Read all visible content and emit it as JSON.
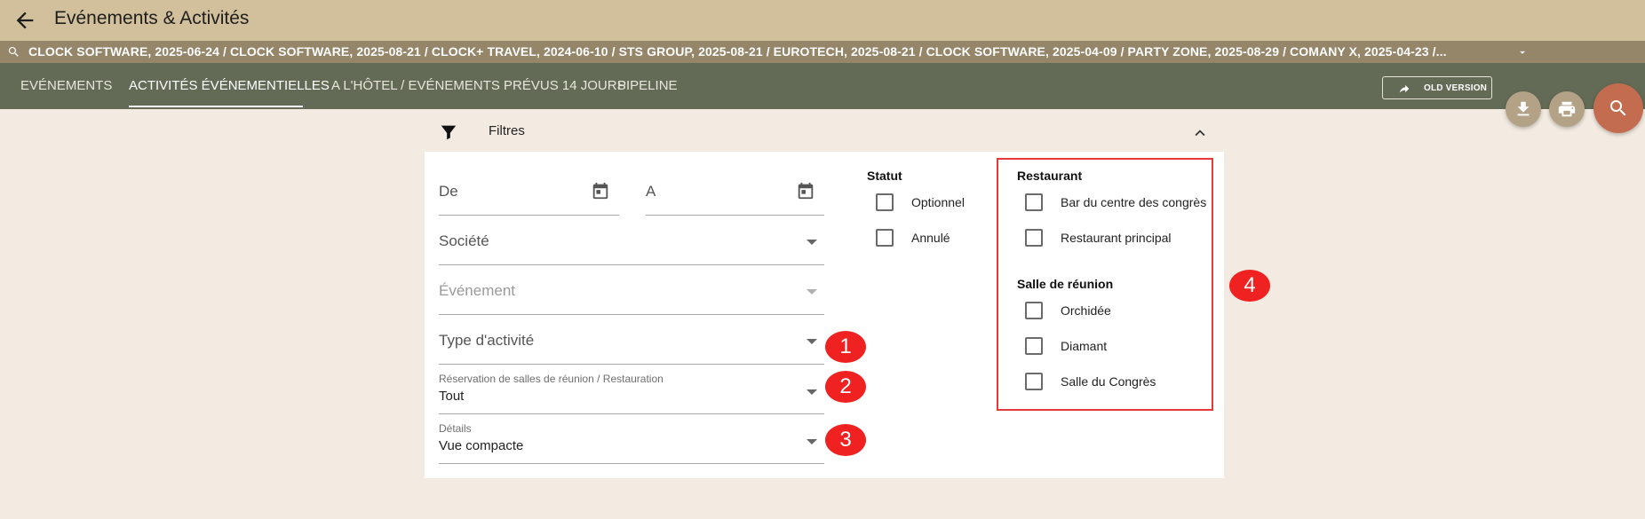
{
  "app": {
    "title": "Evénements & Activités"
  },
  "breadcrumbs": {
    "text": "CLOCK SOFTWARE, 2025-06-24  /  CLOCK SOFTWARE, 2025-08-21  /  CLOCK+ TRAVEL, 2024-06-10  /  STS GROUP, 2025-08-21  /  EUROTECH, 2025-08-21  /  CLOCK SOFTWARE, 2025-04-09  /  PARTY ZONE, 2025-08-29  /  COMANY X, 2025-04-23  /..."
  },
  "tabs": [
    {
      "label": "EVÉNEMENTS"
    },
    {
      "label": "ACTIVITÉS ÉVÉNEMENTIELLES"
    },
    {
      "label": "A L'HÔTEL / EVÉNEMENTS PRÉVUS 14 JOURS"
    },
    {
      "label": "PIPELINE"
    }
  ],
  "old_version": {
    "label": "OLD VERSION"
  },
  "filters": {
    "title": "Filtres",
    "from_label": "De",
    "to_label": "A",
    "company_label": "Société",
    "event_label": "Événement",
    "activity_type_label": "Type d'activité",
    "booking": {
      "label": "Réservation de salles de réunion / Restauration",
      "value": "Tout"
    },
    "details": {
      "label": "Détails",
      "value": "Vue compacte"
    },
    "statut": {
      "title": "Statut",
      "options": [
        "Optionnel",
        "Annulé"
      ]
    },
    "restaurant": {
      "title": "Restaurant",
      "options": [
        "Bar du centre des congrès",
        "Restaurant principal"
      ]
    },
    "meeting_room": {
      "title": "Salle de réunion",
      "options": [
        "Orchidée",
        "Diamant",
        "Salle du Congrès"
      ]
    }
  },
  "markers": [
    "1",
    "2",
    "3",
    "4"
  ],
  "colors": {
    "topbar": "#d2c09c",
    "crumbbar": "#958569",
    "navbar": "#636b56",
    "background": "#f3ebe1",
    "fab_small": "#b3a286",
    "fab_search": "#c36c50",
    "marker": "#ef2121"
  },
  "icons": [
    "arrow-back-icon",
    "search-icon",
    "chevron-down-icon",
    "share-icon",
    "download-icon",
    "print-icon",
    "filter-icon",
    "chevron-up-icon",
    "calendar-icon"
  ]
}
